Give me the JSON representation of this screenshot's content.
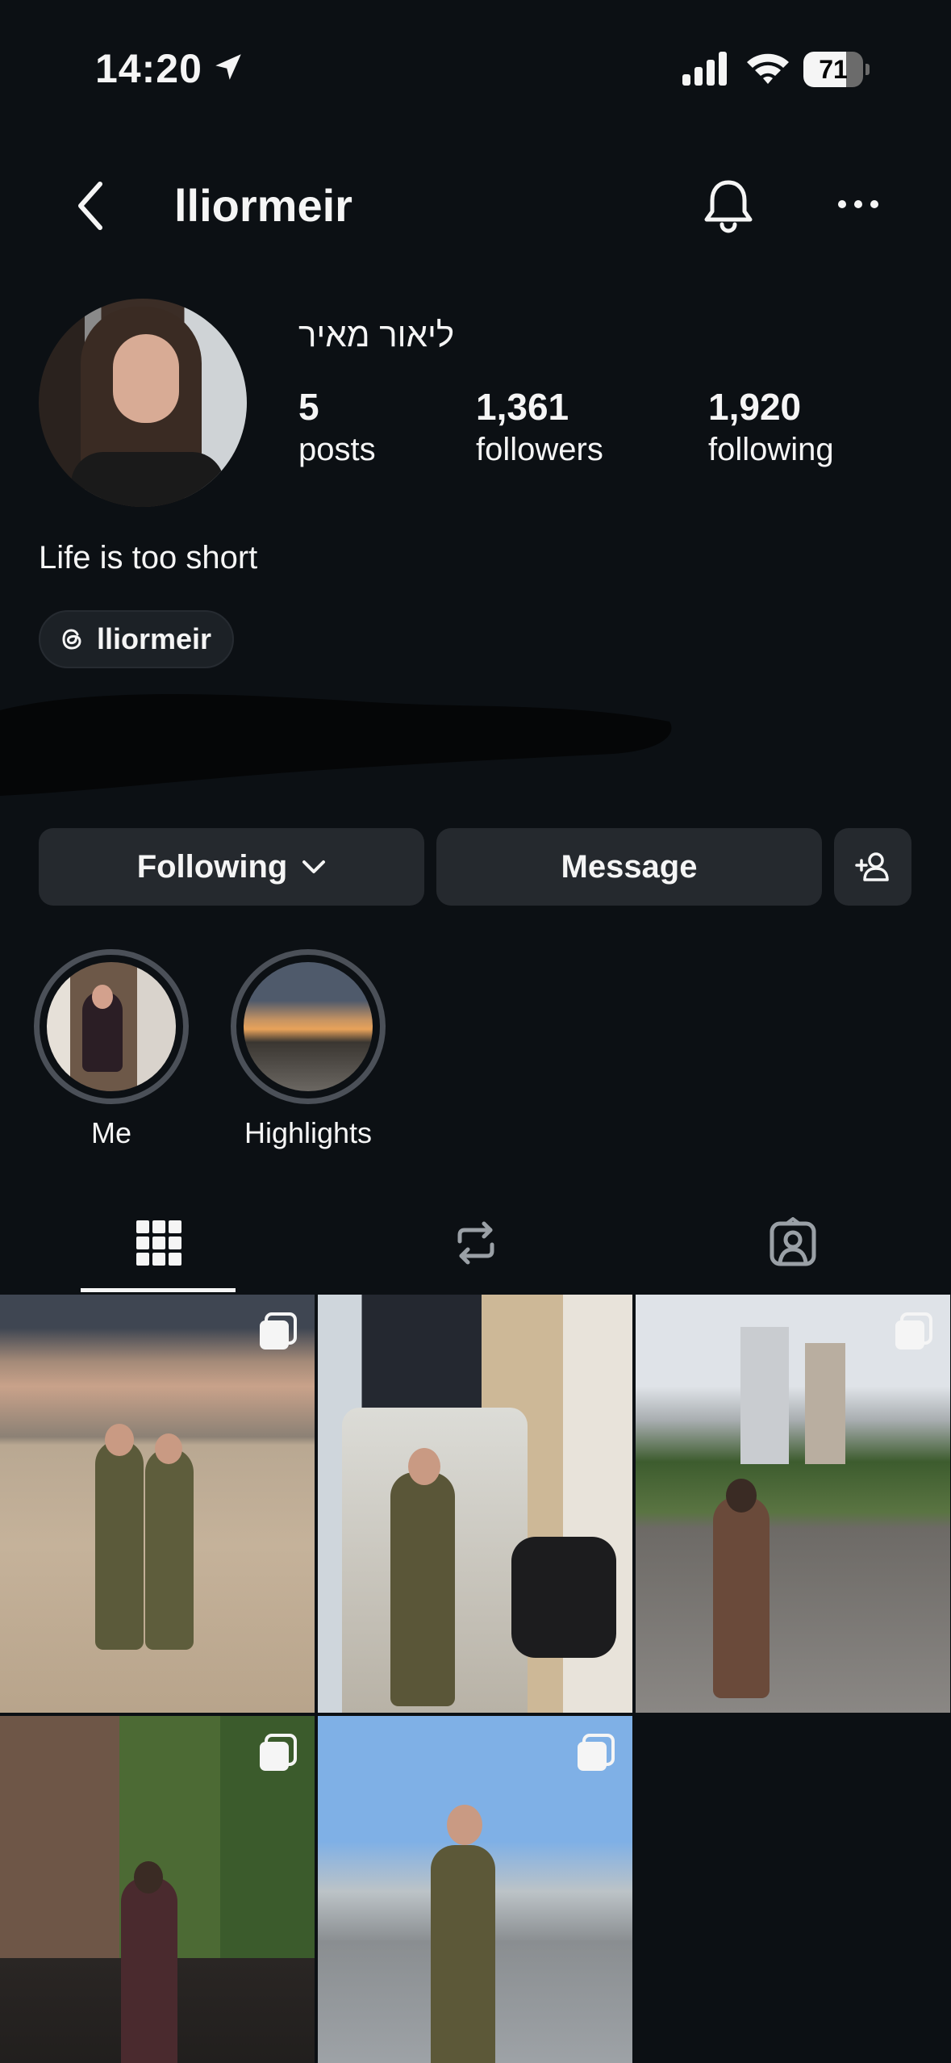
{
  "status_bar": {
    "time": "14:20",
    "battery_percent": "71",
    "battery_level": 0.71
  },
  "header": {
    "username": "lliormeir"
  },
  "profile": {
    "display_name": "ליאור מאיר",
    "stats": [
      {
        "value": "5",
        "label": "posts"
      },
      {
        "value": "1,361",
        "label": "followers"
      },
      {
        "value": "1,920",
        "label": "following"
      }
    ],
    "bio": "Life is too short",
    "threads_handle": "lliormeir"
  },
  "actions": {
    "following_label": "Following",
    "message_label": "Message",
    "add_user_icon": "person-add-icon"
  },
  "highlights": [
    {
      "label": "Me"
    },
    {
      "label": "Highlights"
    }
  ],
  "tabs": [
    {
      "name": "grid",
      "icon": "grid-icon",
      "active": true
    },
    {
      "name": "reposts",
      "icon": "repost-icon",
      "active": false
    },
    {
      "name": "tagged",
      "icon": "tagged-icon",
      "active": false
    }
  ],
  "posts": [
    {
      "multi": true
    },
    {
      "multi": false
    },
    {
      "multi": true
    },
    {
      "multi": true
    },
    {
      "multi": true
    }
  ],
  "colors": {
    "background": "#0c1014",
    "button": "#25292e",
    "text": "#f5f5f5",
    "highlight_ring": "#4b5058"
  }
}
